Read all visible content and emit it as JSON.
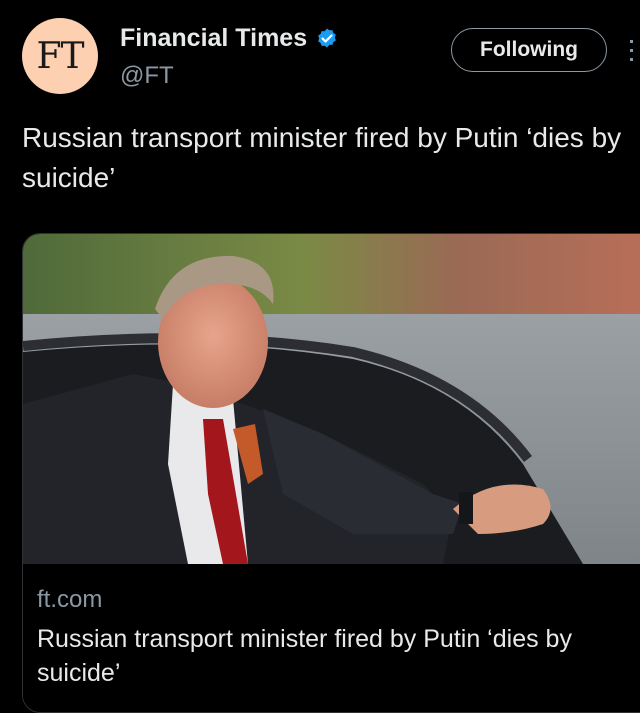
{
  "account": {
    "avatar_text": "FT",
    "display_name": "Financial Times",
    "handle": "@FT",
    "verified": true
  },
  "follow_button": {
    "label": "Following"
  },
  "tweet": {
    "text": "Russian transport minister fired by Putin ‘dies by suicide’"
  },
  "link_card": {
    "domain": "ft.com",
    "title": "Russian transport minister fired by Putin ‘dies by suicide’",
    "image_description_icon": "photo"
  },
  "colors": {
    "background": "#000000",
    "text_primary": "#e7e9ea",
    "text_secondary": "#8b98a5",
    "verified_badge": "#1d9bf0",
    "avatar_bg": "#fcd0b1"
  }
}
